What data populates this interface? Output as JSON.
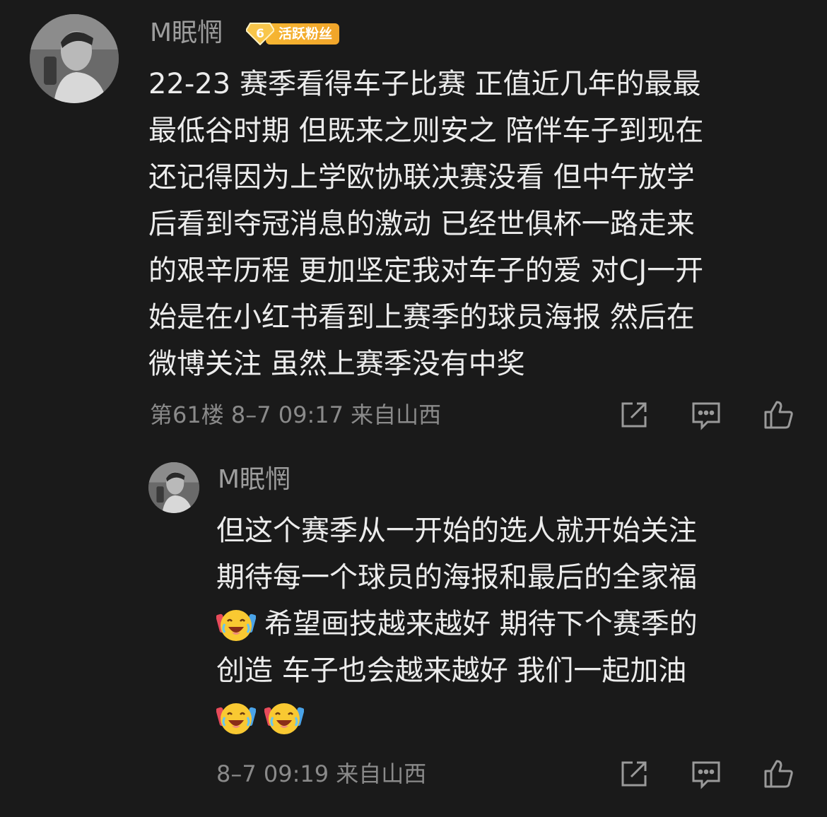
{
  "comment": {
    "username": "M眠惘",
    "badge_level": "6",
    "badge_text": "活跃粉丝",
    "lines": [
      "22-23 赛季看得车子比赛 正值近几年的最最",
      "最低谷时期 但既来之则安之 陪伴车子到现在",
      "还记得因为上学欧协联决赛没看 但中午放学",
      "后看到夺冠消息的激动 已经世俱杯一路走来",
      "的艰辛历程 更加坚定我对车子的爱 对CJ一开",
      "始是在小红书看到上赛季的球员海报 然后在",
      "微博关注 虽然上赛季没有中奖"
    ],
    "meta": "第61楼  8–7 09:17  来自山西"
  },
  "reply": {
    "username": "M眠惘",
    "line1": "但这个赛季从一开始的选人就开始关注",
    "line2": "期待每一个球员的海报和最后的全家福",
    "line3": "希望画技越来越好 期待下个赛季的",
    "line4": "创造 车子也会越来越好 我们一起加油",
    "meta": "8–7 09:19  来自山西"
  },
  "icons": {
    "share": "share-icon",
    "comment": "comment-icon",
    "like": "thumbs-up-icon",
    "emoji": "laughing-cheer-emoji"
  },
  "colors": {
    "background": "#1a1a1a",
    "badge": "#f3ab2d"
  }
}
